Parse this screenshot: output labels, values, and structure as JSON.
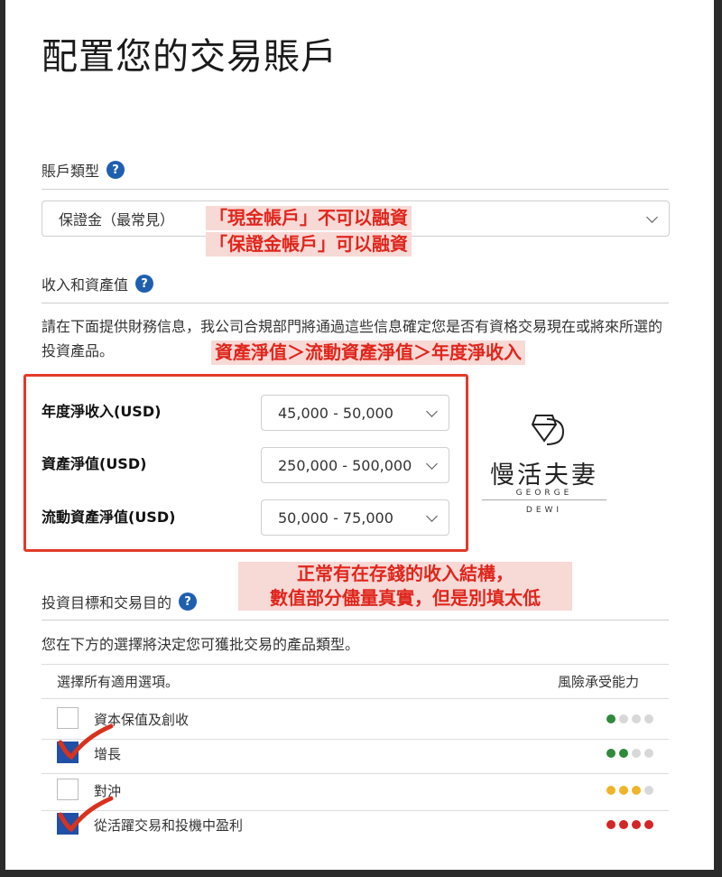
{
  "page": {
    "title": "配置您的交易賬戶"
  },
  "account_type": {
    "heading": "賬戶類型",
    "help": "?",
    "selected": "保證金（最常見）",
    "annotation_line1": "「現金帳戶」不可以融資",
    "annotation_line2": "「保證金帳戶」可以融資"
  },
  "income_assets": {
    "heading": "收入和資產值",
    "help": "?",
    "description": "請在下面提供財務信息，我公司合規部門將通過這些信息確定您是否有資格交易現在或將來所選的投資產品。",
    "annotation": "資產淨值＞流動資產淨值＞年度淨收入",
    "fields": [
      {
        "label": "年度淨收入(USD)",
        "value": "45,000 - 50,000"
      },
      {
        "label": "資產淨值(USD)",
        "value": "250,000 - 500,000"
      },
      {
        "label": "流動資產淨值(USD)",
        "value": "50,000 - 75,000"
      }
    ],
    "annotation2_line1": "正常有在存錢的收入結構，",
    "annotation2_line2": "數值部分儘量真實，但是別填太低"
  },
  "logo": {
    "name": "慢活夫妻",
    "sub1": "GEORGE",
    "sub2": "DEWI"
  },
  "objectives": {
    "heading": "投資目標和交易目的",
    "help": "?",
    "description": "您在下方的選擇將決定您可獲批交易的產品類型。",
    "col_left": "選擇所有適用選項。",
    "col_right": "風險承受能力",
    "options": [
      {
        "label": "資本保值及創收",
        "checked": false,
        "risk": 1,
        "risk_color": "#2e8b3a"
      },
      {
        "label": "增長",
        "checked": true,
        "risk": 2,
        "risk_color": "#2e8b3a"
      },
      {
        "label": "對沖",
        "checked": false,
        "risk": 3,
        "risk_color": "#f0b429"
      },
      {
        "label": "從活躍交易和投機中盈利",
        "checked": true,
        "risk": 4,
        "risk_color": "#d32626"
      }
    ]
  },
  "colors": {
    "accent": "#1f5fb0",
    "annotation": "#e0261c",
    "checked": "#1f4fa6"
  }
}
